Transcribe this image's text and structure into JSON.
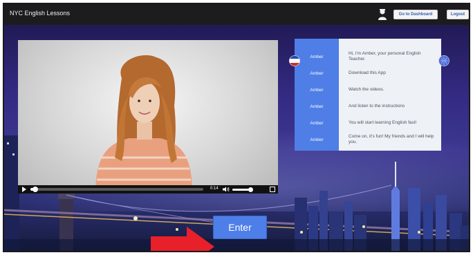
{
  "header": {
    "title": "NYC English Lessons",
    "dashboard_label": "Go to Dashboard",
    "logout_label": "Logout"
  },
  "video": {
    "time": "0:14",
    "progress": 0.02,
    "volume": 0.85
  },
  "chat": {
    "messages": [
      {
        "name": "Amber",
        "text": "Hi, I'm Amber, your personal English Teacher."
      },
      {
        "name": "Amber",
        "text": "Download this App"
      },
      {
        "name": "Amber",
        "text": "Watch the videos."
      },
      {
        "name": "Amber",
        "text": "And listen to the instructions"
      },
      {
        "name": "Amber",
        "text": "You will start learning English fast!"
      },
      {
        "name": "Amber",
        "text": "Come on, it's fun! My friends and I will help you."
      }
    ]
  },
  "main": {
    "enter_label": "Enter"
  },
  "colors": {
    "accent": "#4e7ee8",
    "arrow": "#e8202a",
    "topbar": "#1c1c1f"
  }
}
